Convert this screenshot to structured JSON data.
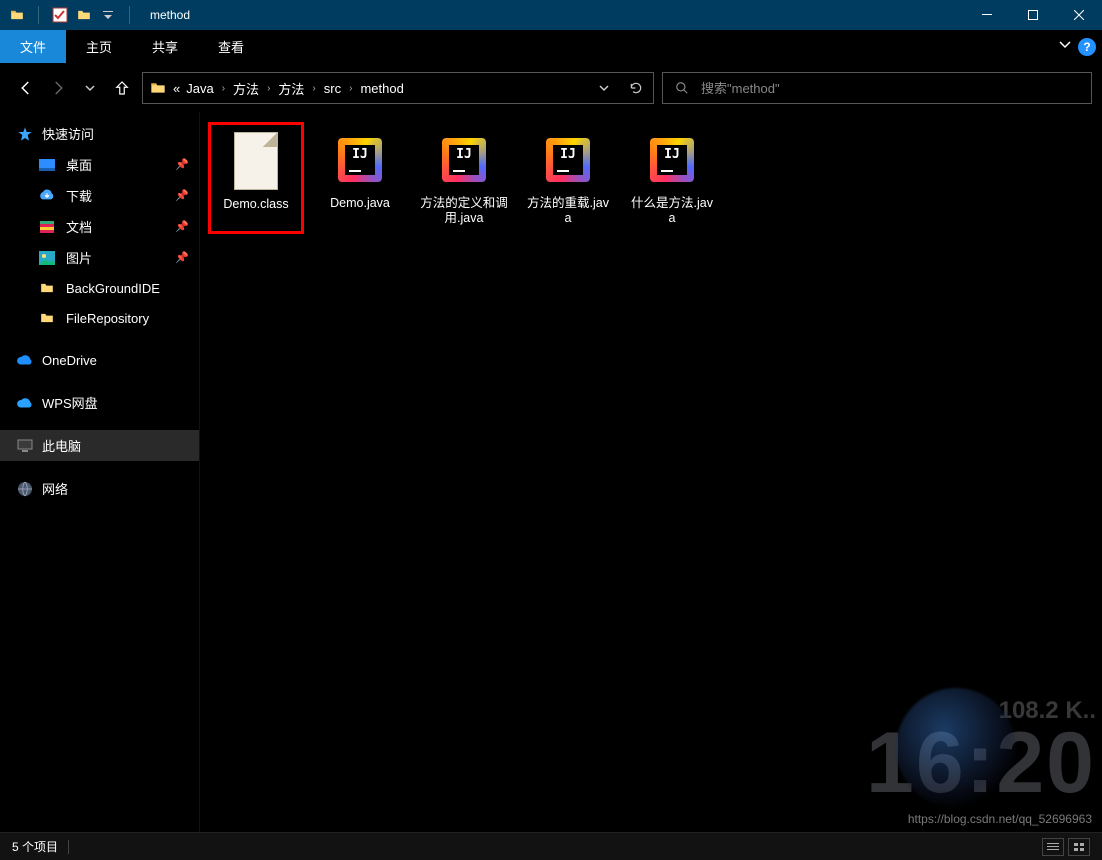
{
  "window": {
    "title": "method"
  },
  "ribbon": {
    "tabs": {
      "file": "文件",
      "home": "主页",
      "share": "共享",
      "view": "查看"
    }
  },
  "breadcrumb": {
    "ellipsis": "«",
    "items": {
      "p0": "Java",
      "p1": "方法",
      "p2": "方法",
      "p3": "src",
      "p4": "method"
    }
  },
  "search": {
    "placeholder": "搜索\"method\""
  },
  "sidebar": {
    "quick": "快速访问",
    "desktop": "桌面",
    "downloads": "下载",
    "documents": "文档",
    "pictures": "图片",
    "bgide": "BackGroundIDE",
    "filerepo": "FileRepository",
    "onedrive": "OneDrive",
    "wps": "WPS网盘",
    "thispc": "此电脑",
    "network": "网络"
  },
  "files": [
    {
      "label": "Demo.class",
      "type": "class"
    },
    {
      "label": "Demo.java",
      "type": "ij"
    },
    {
      "label": "方法的定义和调用.java",
      "type": "ij"
    },
    {
      "label": "方法的重载.java",
      "type": "ij"
    },
    {
      "label": "什么是方法.java",
      "type": "ij"
    }
  ],
  "status": {
    "count": "5 个项目"
  },
  "overlay": {
    "speed": "108.2 K..",
    "time": "16:20"
  },
  "watermark": "https://blog.csdn.net/qq_52696963"
}
